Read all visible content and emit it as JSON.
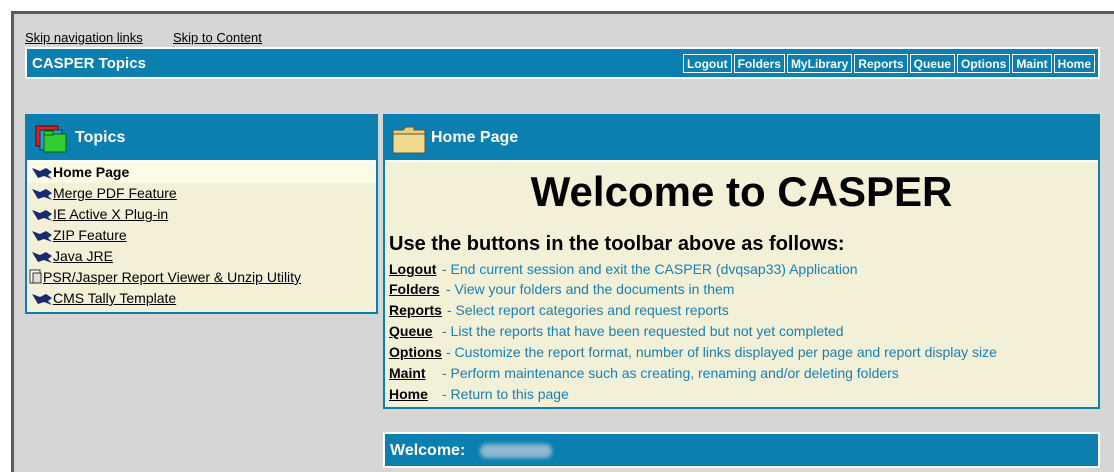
{
  "skip_links": {
    "nav": "Skip navigation links",
    "content": "Skip to Content"
  },
  "app": {
    "title": "CASPER Topics"
  },
  "toolbar": [
    "Logout",
    "Folders",
    "MyLibrary",
    "Reports",
    "Queue",
    "Options",
    "Maint",
    "Home"
  ],
  "topics_panel": {
    "title": "Topics",
    "items": [
      "Home Page",
      "Merge PDF Feature",
      "IE Active X Plug-in",
      "ZIP Feature",
      "Java JRE",
      "PSR/Jasper Report Viewer & Unzip Utility",
      "CMS Tally Template"
    ]
  },
  "main": {
    "title": "Home Page",
    "heading": "Welcome to CASPER",
    "subheading": "Use the buttons in the toolbar above as follows:",
    "commands": [
      {
        "name": "Logout",
        "desc": "- End current session and exit the CASPER (dvqsap33) Application"
      },
      {
        "name": "Folders",
        "desc": "- View your folders and the documents in them"
      },
      {
        "name": "Reports",
        "desc": "- Select report categories and request reports"
      },
      {
        "name": "Queue",
        "desc": "- List the reports that have been requested but not yet completed"
      },
      {
        "name": "Options",
        "desc": "- Customize the report format, number of links displayed per page and report display size"
      },
      {
        "name": "Maint",
        "desc": "- Perform maintenance such as creating, renaming and/or deleting folders"
      },
      {
        "name": "Home",
        "desc": "- Return to this page"
      }
    ]
  },
  "welcome_bar": {
    "label": "Welcome:"
  },
  "colors": {
    "accent": "#0a7fb0",
    "panel_bg": "#f3f0d8",
    "link_desc": "#1a7fb3",
    "page_bg": "#d6d6d6"
  }
}
